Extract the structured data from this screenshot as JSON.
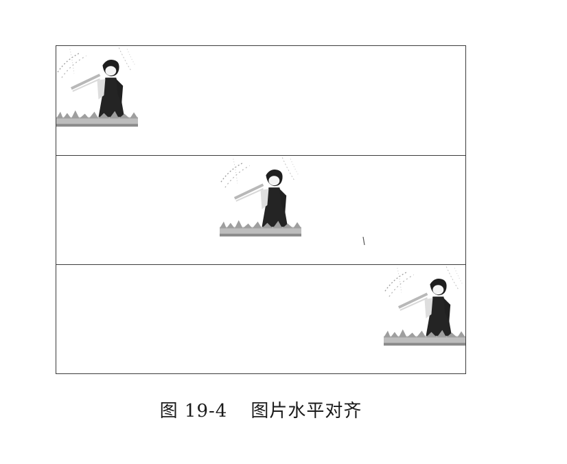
{
  "figure": {
    "alignment_rows": [
      {
        "align": "left"
      },
      {
        "align": "center"
      },
      {
        "align": "right"
      }
    ]
  },
  "caption": {
    "label": "图 19-4",
    "title": "图片水平对齐"
  },
  "colors": {
    "border": "#3a3a3a",
    "text": "#1a1a1a"
  }
}
